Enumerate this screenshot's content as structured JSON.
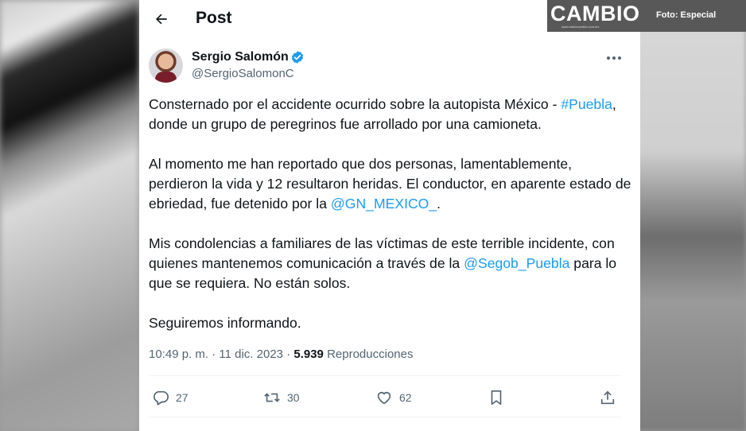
{
  "header": {
    "title": "Post"
  },
  "author": {
    "name": "Sergio Salomón",
    "handle": "@SergioSalomonC"
  },
  "tweet": {
    "p1_a": "Consternado por el accidente ocurrido sobre la autopista México -",
    "p1_hashtag": "#Puebla",
    "p1_b": ", donde un grupo de peregrinos fue arrollado por una camioneta.",
    "p2_a": "Al momento me han reportado que dos personas, lamentablemente, perdieron la vida y 12 resultaron heridas. El conductor, en aparente estado de ebriedad, fue detenido por la",
    "p2_mention": "@GN_MEXICO_",
    "p2_b": ".",
    "p3_a": "Mis condolencias a familiares de las víctimas de este terrible incidente, con quienes mantenemos comunicación a través de la",
    "p3_mention": "@Segob_Puebla",
    "p3_b": "para lo que se requiera. No están solos.",
    "p4": "Seguiremos informando."
  },
  "meta": {
    "time": "10:49 p. m.",
    "sep1": "·",
    "date": "11 dic. 2023",
    "sep2": "·",
    "views": "5.939",
    "views_label": "Reproducciones"
  },
  "actions": {
    "replies": "27",
    "reposts": "30",
    "likes": "62"
  },
  "overlay": {
    "logo": "CAMBIO",
    "logo_sub": "www.diariocambio.com.mx",
    "credit": "Foto: Especial"
  },
  "colors": {
    "link": "#1d9bf0",
    "text": "#0f1419",
    "muted": "#536471"
  },
  "icons": {
    "back": "arrow-left-icon",
    "verified": "verified-badge-icon",
    "more": "more-dots-icon",
    "reply": "comment-icon",
    "repost": "repost-icon",
    "like": "heart-icon",
    "bookmark": "bookmark-icon",
    "share": "share-icon"
  }
}
